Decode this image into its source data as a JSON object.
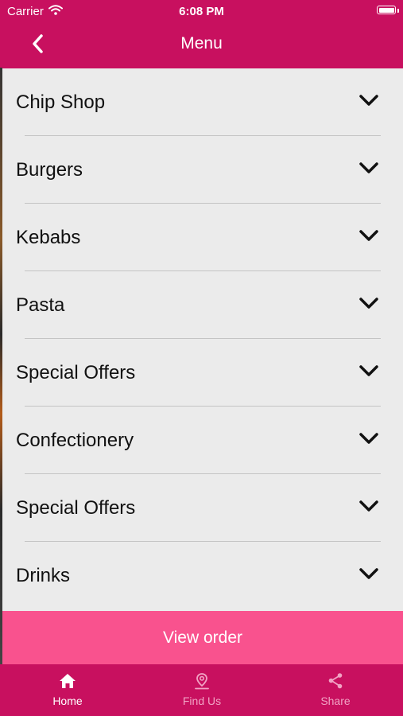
{
  "status_bar": {
    "carrier": "Carrier",
    "time": "6:08 PM"
  },
  "nav": {
    "title": "Menu"
  },
  "menu_items": [
    {
      "label": "Chip Shop"
    },
    {
      "label": "Burgers"
    },
    {
      "label": "Kebabs"
    },
    {
      "label": "Pasta"
    },
    {
      "label": "Special Offers"
    },
    {
      "label": "Confectionery"
    },
    {
      "label": "Special Offers"
    },
    {
      "label": "Drinks"
    }
  ],
  "view_order": {
    "label": "View order"
  },
  "tab_bar": {
    "tabs": [
      {
        "label": "Home",
        "icon": "home-icon",
        "active": true
      },
      {
        "label": "Find Us",
        "icon": "location-pin-icon",
        "active": false
      },
      {
        "label": "Share",
        "icon": "share-icon",
        "active": false
      }
    ]
  },
  "colors": {
    "brand": "#c8105f",
    "button": "#f9528e",
    "list_background": "#ebebeb",
    "inactive_tab": "#f1a3c4"
  }
}
